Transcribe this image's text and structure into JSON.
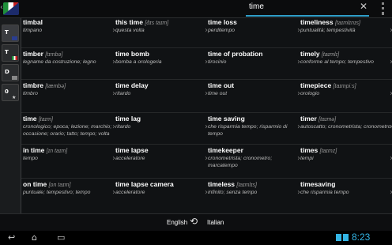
{
  "topbar": {
    "search_value": "time",
    "clear_icon": "close-icon"
  },
  "sidebar": {
    "buttons": [
      {
        "label": "T",
        "icon": "flag-uk-icon"
      },
      {
        "label": "T",
        "icon": "flag-it-icon"
      },
      {
        "label": "D",
        "icon": "book-icon"
      },
      {
        "label": "0",
        "icon": "star-icon"
      }
    ]
  },
  "entries": [
    {
      "term": "timbal",
      "phon": "",
      "trans": "timpano"
    },
    {
      "term": "this time",
      "phon": "[ðɪs taɪm]",
      "trans": "questa volta"
    },
    {
      "term": "time loss",
      "phon": "",
      "trans": "perditempo"
    },
    {
      "term": "timeliness",
      "phon": "[taɪmlɪnɪs]",
      "trans": "puntualità; tempestività"
    },
    {
      "term": "timber",
      "phon": "[tɪmbə]",
      "trans": "legname da costruzione; legno"
    },
    {
      "term": "time bomb",
      "phon": "",
      "trans": "bomba a orologeria"
    },
    {
      "term": "time of probation",
      "phon": "",
      "trans": "tirocinio"
    },
    {
      "term": "timely",
      "phon": "[taɪmlɪ]",
      "trans": "conforme al tempo; tempestivo"
    },
    {
      "term": "timbre",
      "phon": "[tæmbə]",
      "trans": "timbro"
    },
    {
      "term": "time delay",
      "phon": "",
      "trans": "ritardo"
    },
    {
      "term": "time out",
      "phon": "",
      "trans": "time out"
    },
    {
      "term": "timepiece",
      "phon": "[taɪmpiːs]",
      "trans": "orologio"
    },
    {
      "term": "time",
      "phon": "[taɪm]",
      "trans": "cronologico; epoca; lezione; marchio; occasione; orario; tatto; tempo; volta"
    },
    {
      "term": "time lag",
      "phon": "",
      "trans": "ritardo"
    },
    {
      "term": "time saving",
      "phon": "",
      "trans": "che risparmia tempo; risparmio di tempo"
    },
    {
      "term": "timer",
      "phon": "[taɪmə]",
      "trans": "autoscatto; cronometrista; cronometro"
    },
    {
      "term": "in time",
      "phon": "[ɪn taɪm]",
      "trans": "tempo"
    },
    {
      "term": "time lapse",
      "phon": "",
      "trans": "acceleratore"
    },
    {
      "term": "timekeeper",
      "phon": "",
      "trans": "cronometrista; cronometro; marcatempo"
    },
    {
      "term": "times",
      "phon": "[taɪmz]",
      "trans": "tempi"
    },
    {
      "term": "on time",
      "phon": "[ɒn taɪm]",
      "trans": "puntuale; tempestivo; tempo"
    },
    {
      "term": "time lapse camera",
      "phon": "",
      "trans": "acceleratore"
    },
    {
      "term": "timeless",
      "phon": "[taɪmlɪs]",
      "trans": "infinito; senza tempo"
    },
    {
      "term": "timesaving",
      "phon": "",
      "trans": "che risparmia tempo"
    }
  ],
  "footer": {
    "from_lang": "English",
    "to_lang": "Italian",
    "swap_icon": "swap-arrows-icon"
  },
  "navbar": {
    "time": "8:23",
    "back_icon": "back-icon",
    "home_icon": "home-icon",
    "recents_icon": "recents-icon"
  }
}
